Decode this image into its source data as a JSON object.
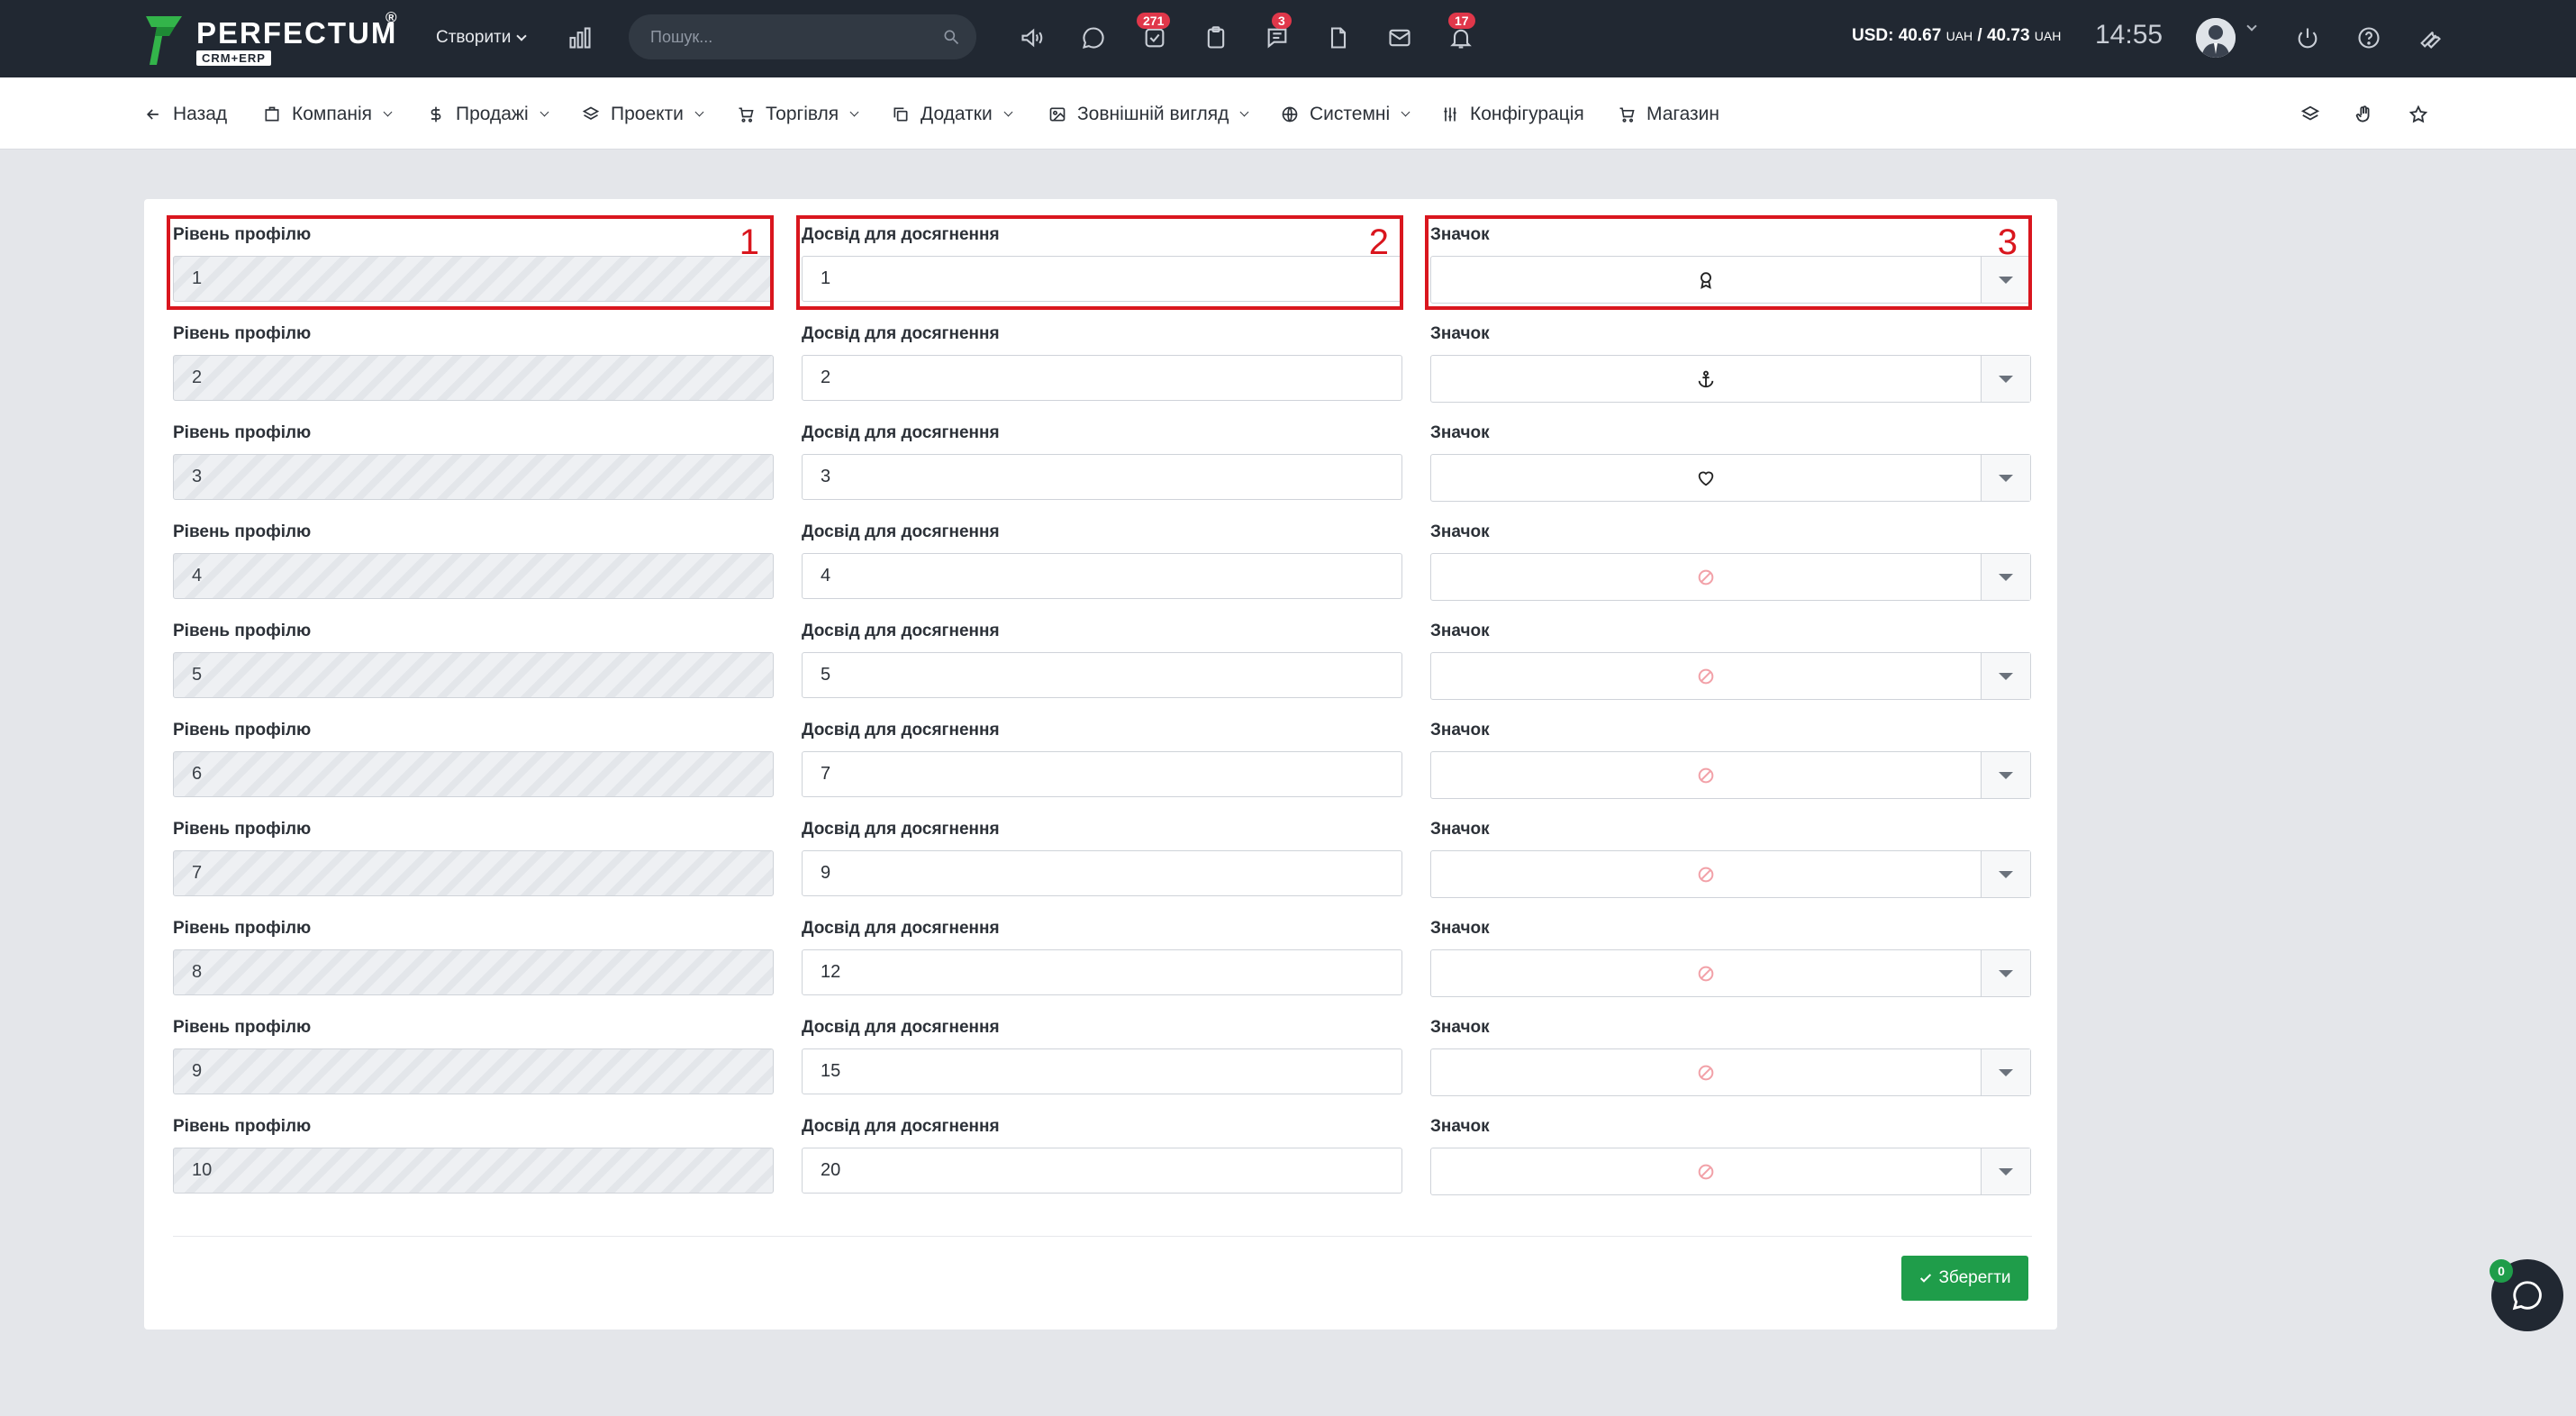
{
  "app": {
    "brand": "PERFECTUM",
    "brand_sub": "CRM+ERP",
    "registered_mark": "®"
  },
  "topbar": {
    "create_label": "Створити",
    "search_placeholder": "Пошук...",
    "badges": {
      "tasks": "271",
      "chat": "3",
      "notifications": "17"
    },
    "currency_prefix": "USD: 40.67",
    "currency_unit1": "UAH",
    "currency_mid": " / 40.73",
    "currency_unit2": "UAH",
    "time": "14:55"
  },
  "nav": {
    "back": "Назад",
    "company": "Компанія",
    "sales": "Продажі",
    "projects": "Проекти",
    "trade": "Торгівля",
    "addons": "Додатки",
    "appearance": "Зовнішній вигляд",
    "system": "Системні",
    "config": "Конфігурація",
    "shop": "Магазин"
  },
  "form": {
    "level_label": "Рівень профілю",
    "xp_label": "Досвід для досягнення",
    "icon_label": "Значок",
    "rows": [
      {
        "level": "1",
        "xp": "1",
        "icon": "award-icon"
      },
      {
        "level": "2",
        "xp": "2",
        "icon": "anchor-icon"
      },
      {
        "level": "3",
        "xp": "3",
        "icon": "heart-icon"
      },
      {
        "level": "4",
        "xp": "4",
        "icon": "none-icon"
      },
      {
        "level": "5",
        "xp": "5",
        "icon": "none-icon"
      },
      {
        "level": "6",
        "xp": "7",
        "icon": "none-icon"
      },
      {
        "level": "7",
        "xp": "9",
        "icon": "none-icon"
      },
      {
        "level": "8",
        "xp": "12",
        "icon": "none-icon"
      },
      {
        "level": "9",
        "xp": "15",
        "icon": "none-icon"
      },
      {
        "level": "10",
        "xp": "20",
        "icon": "none-icon"
      }
    ],
    "save_label": "Зберегти"
  },
  "annotations": [
    "1",
    "2",
    "3"
  ],
  "chat": {
    "badge": "0"
  },
  "colors": {
    "topbar": "#212832",
    "accent_green": "#1f9d4a",
    "badge_red": "#e0374a",
    "highlight_red": "#d9161e"
  }
}
